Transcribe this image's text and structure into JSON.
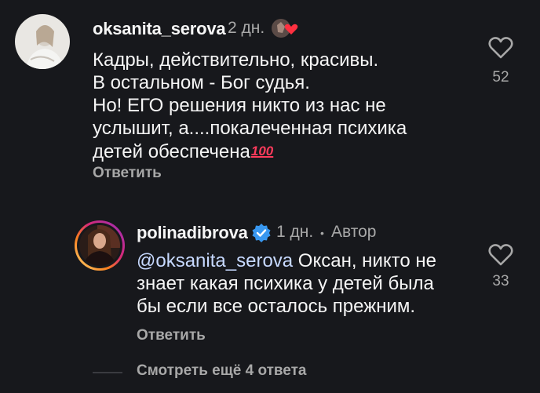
{
  "comment": {
    "username": "oksanita_serova",
    "time": "2 дн.",
    "lines": [
      "Кадры, действительно, красивы.",
      "В остальном - Бог судья.",
      "Но! ЕГО решения никто из нас не",
      "услышит, а....покалеченная психика",
      "детей обеспечена"
    ],
    "emoji": "💯",
    "reply_label": "Ответить",
    "likes": "52"
  },
  "reply": {
    "username": "polinadibrova",
    "verified_icon": "verified-badge-icon",
    "time": "1 дн.",
    "separator": "•",
    "author_label": "Автор",
    "mention": "@oksanita_serova",
    "lines": [
      " Оксан, никто не",
      "знает какая психика у детей была",
      "бы если все осталось прежним."
    ],
    "reply_label": "Ответить",
    "likes": "33"
  },
  "view_more_label": "Смотреть ещё 4 ответа",
  "colors": {
    "background": "#17181c",
    "text": "#f5f5f5",
    "secondary": "#a8a8a8",
    "verified": "#3897f0",
    "story_ring": "#d62976"
  }
}
